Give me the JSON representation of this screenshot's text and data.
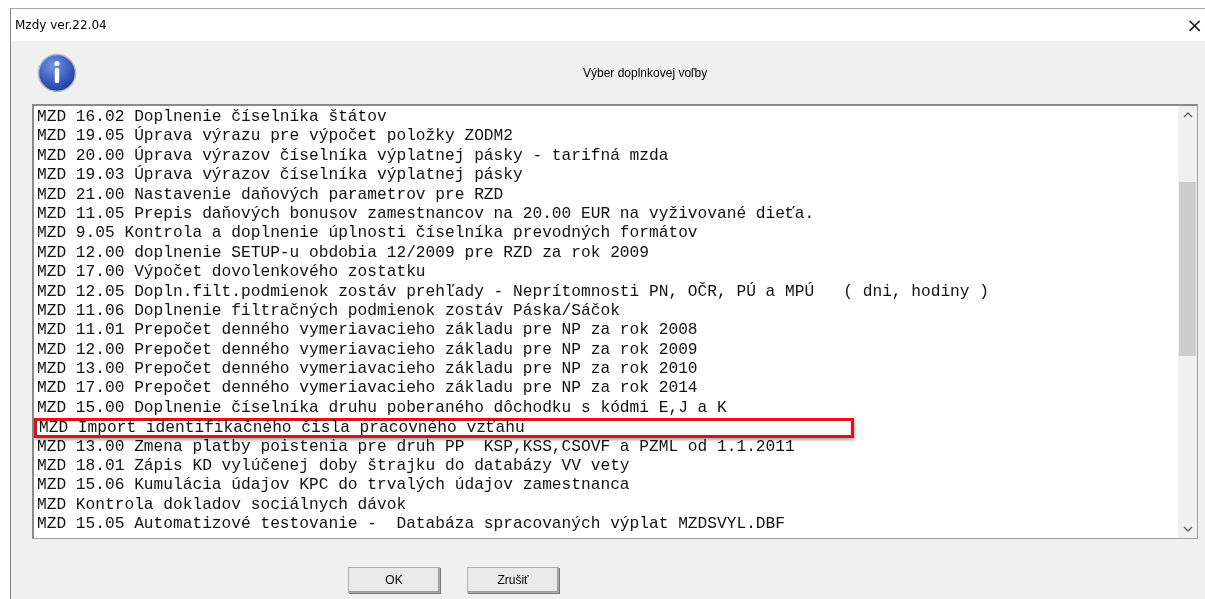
{
  "window": {
    "title": "Mzdy ver.22.04",
    "close": "×"
  },
  "heading": "Výber doplnkovej voľby",
  "rows": [
    {
      "text": "MZD 16.02 Doplnenie číselníka štátov",
      "highlighted": false
    },
    {
      "text": "MZD 19.05 Úprava výrazu pre výpočet položky ZODM2",
      "highlighted": false
    },
    {
      "text": "MZD 20.00 Úprava výrazov číselníka výplatnej pásky - tarifná mzda",
      "highlighted": false
    },
    {
      "text": "MZD 19.03 Úprava výrazov číselníka výplatnej pásky",
      "highlighted": false
    },
    {
      "text": "MZD 21.00 Nastavenie daňových parametrov pre RZD",
      "highlighted": false
    },
    {
      "text": "MZD 11.05 Prepis daňových bonusov zamestnancov na 20.00 EUR na vyživované dieťa.",
      "highlighted": false
    },
    {
      "text": "MZD 9.05 Kontrola a doplnenie úplnosti číselníka prevodných formátov",
      "highlighted": false
    },
    {
      "text": "MZD 12.00 doplnenie SETUP-u obdobia 12/2009 pre RZD za rok 2009",
      "highlighted": false
    },
    {
      "text": "MZD 17.00 Výpočet dovolenkového zostatku",
      "highlighted": false
    },
    {
      "text": "MZD 12.05 Dopln.filt.podmienok zostáv prehľady - Neprítomnosti PN, OČR, PÚ a MPÚ   ( dni, hodiny )",
      "highlighted": false
    },
    {
      "text": "MZD 11.06 Doplnenie filtračných podmienok zostáv Páska/Sáčok",
      "highlighted": false
    },
    {
      "text": "MZD 11.01 Prepočet denného vymeriavacieho základu pre NP za rok 2008",
      "highlighted": false
    },
    {
      "text": "MZD 12.00 Prepočet denného vymeriavacieho základu pre NP za rok 2009",
      "highlighted": false
    },
    {
      "text": "MZD 13.00 Prepočet denného vymeriavacieho základu pre NP za rok 2010",
      "highlighted": false
    },
    {
      "text": "MZD 17.00 Prepočet denného vymeriavacieho základu pre NP za rok 2014",
      "highlighted": false
    },
    {
      "text": "MZD 15.00 Doplnenie číselníka druhu poberaného dôchodku s kódmi E,J a K",
      "highlighted": false
    },
    {
      "text": "MZD Import identifikačného čísla pracovného vzťahu",
      "highlighted": true
    },
    {
      "text": "MZD 13.00 Zmena platby poistenia pre druh PP  KSP,KSS,CSOVF a PZML od 1.1.2011",
      "highlighted": false
    },
    {
      "text": "MZD 18.01 Zápis KD vylúčenej doby štrajku do databázy VV vety",
      "highlighted": false
    },
    {
      "text": "MZD 15.06 Kumulácia údajov KPC do trvalých údajov zamestnanca",
      "highlighted": false
    },
    {
      "text": "MZD Kontrola dokladov sociálnych dávok",
      "highlighted": false
    },
    {
      "text": "MZD 15.05 Automatizové testovanie -  Databáza spracovaných výplat MZDSVYL.DBF",
      "highlighted": false
    }
  ],
  "buttons": [
    "OK",
    "Zrušiť"
  ]
}
